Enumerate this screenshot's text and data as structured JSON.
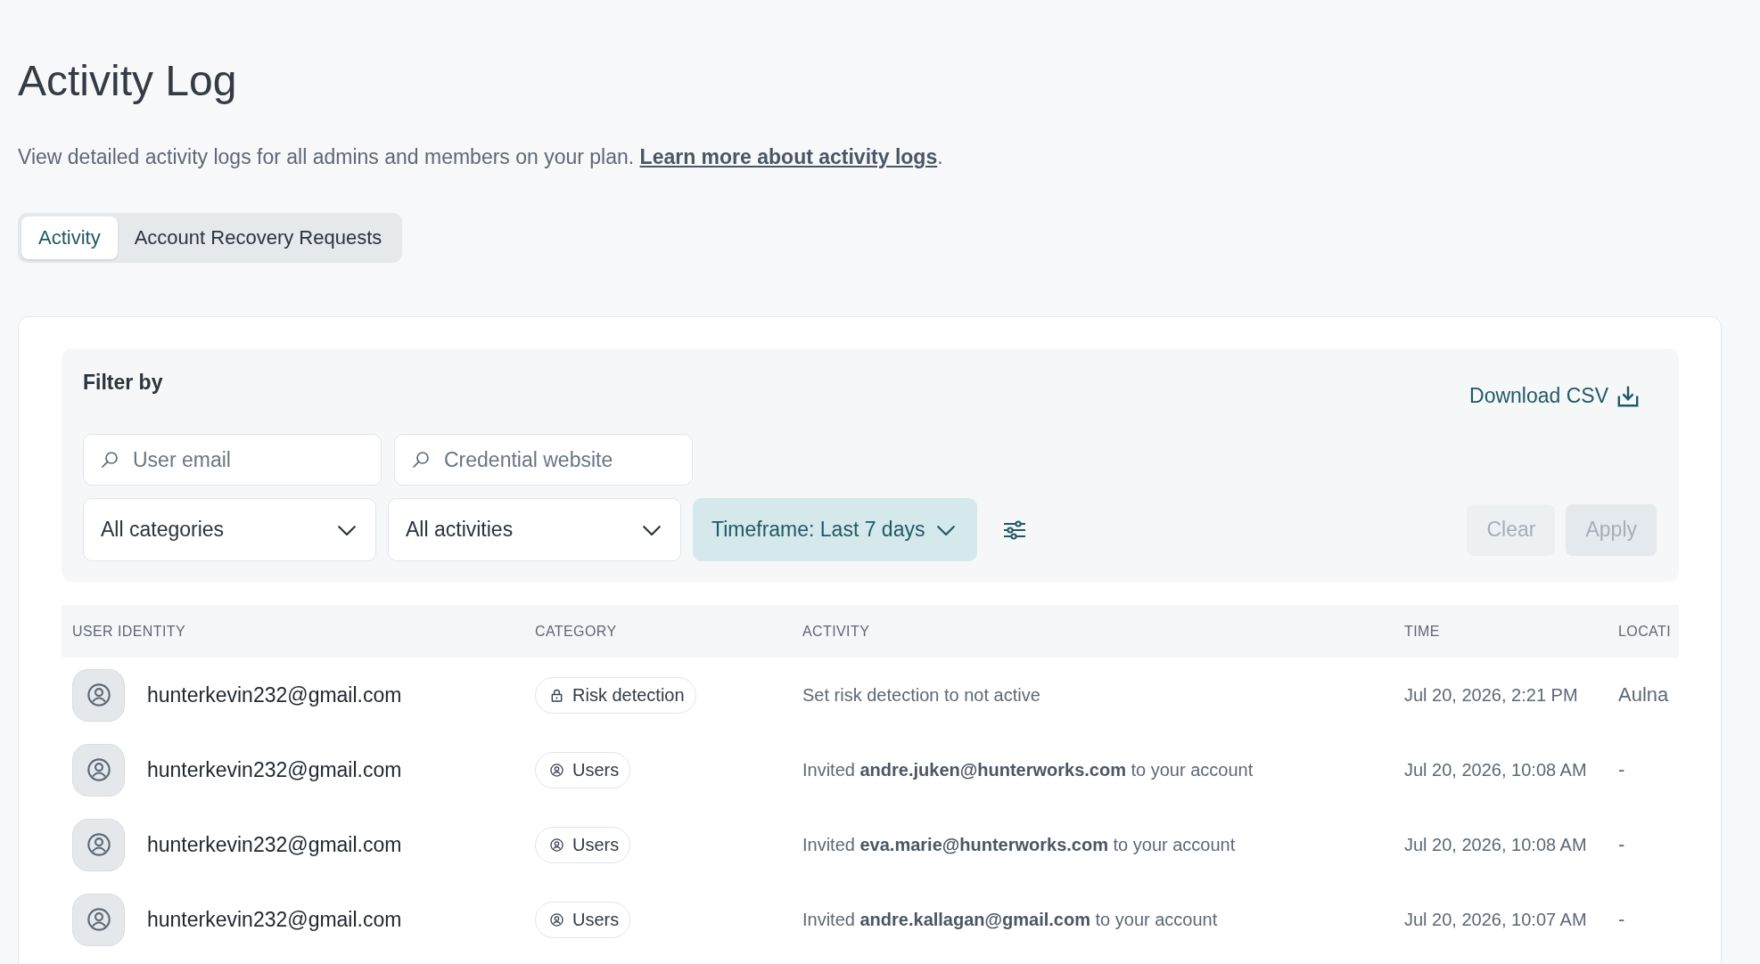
{
  "page": {
    "title": "Activity Log",
    "description": "View detailed activity logs for all admins and members on your plan.",
    "link": "Learn more about activity logs",
    "description_end": "."
  },
  "tabs": [
    {
      "label": "Activity",
      "selected": true
    },
    {
      "label": "Account Recovery Requests",
      "selected": false
    }
  ],
  "filters": {
    "title": "Filter by",
    "download": "Download CSV",
    "search_fields": [
      {
        "placeholder": "User email"
      },
      {
        "placeholder": "Credential website"
      }
    ],
    "dropdowns": [
      {
        "label": "All categories",
        "active": false
      },
      {
        "label": "All activities",
        "active": false
      },
      {
        "label": "Timeframe: Last 7 days",
        "active": true
      }
    ],
    "buttons": [
      {
        "label": "Clear",
        "kind": "secondary",
        "disabled": true
      },
      {
        "label": "Apply",
        "kind": "primary",
        "disabled": true
      }
    ]
  },
  "table": {
    "columns": [
      "USER IDENTITY",
      "CATEGORY",
      "ACTIVITY",
      "TIME",
      "LOCATI"
    ],
    "rows": [
      {
        "user": "hunterkevin232@gmail.com",
        "category": {
          "label": "Risk detection",
          "kind": "risk"
        },
        "activity": "Set risk detection to not active",
        "time": "Jul 20, 2026, 2:21 PM",
        "location": "Aulna"
      },
      {
        "user": "hunterkevin232@gmail.com",
        "category": {
          "label": "Users",
          "kind": "users"
        },
        "activity": "Invited **andre.juken@hunterworks.com** to your account",
        "time": "Jul 20, 2026, 10:08 AM",
        "location": "-"
      },
      {
        "user": "hunterkevin232@gmail.com",
        "category": {
          "label": "Users",
          "kind": "users"
        },
        "activity": "Invited **eva.marie@hunterworks.com** to your account",
        "time": "Jul 20, 2026, 10:08 AM",
        "location": "-"
      },
      {
        "user": "hunterkevin232@gmail.com",
        "category": {
          "label": "Users",
          "kind": "users"
        },
        "activity": "Invited **andre.kallagan@gmail.com** to your account",
        "time": "Jul 20, 2026, 10:07 AM",
        "location": "-"
      }
    ]
  }
}
